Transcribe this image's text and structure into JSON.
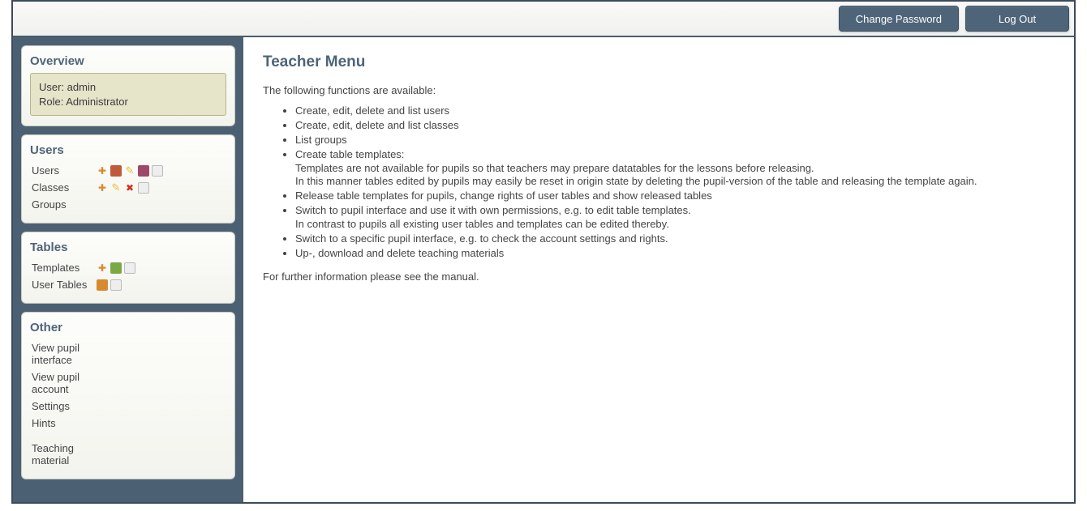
{
  "topbar": {
    "change_password": "Change Password",
    "log_out": "Log Out"
  },
  "sidebar": {
    "overview": {
      "heading": "Overview",
      "user_line": "User: admin",
      "role_line": "Role: Administrator"
    },
    "users": {
      "heading": "Users",
      "items": [
        {
          "label": "Users",
          "icons": [
            "add-user-icon",
            "group-icon",
            "edit-icon",
            "user-delete-icon",
            "list-icon"
          ]
        },
        {
          "label": "Classes",
          "icons": [
            "add-icon",
            "edit-icon",
            "delete-icon",
            "list-icon"
          ]
        },
        {
          "label": "Groups",
          "icons": []
        }
      ]
    },
    "tables": {
      "heading": "Tables",
      "items": [
        {
          "label": "Templates",
          "icons": [
            "add-icon",
            "release-icon",
            "list-icon"
          ]
        },
        {
          "label": "User Tables",
          "icons": [
            "rights-icon",
            "list-icon"
          ]
        }
      ]
    },
    "other": {
      "heading": "Other",
      "items": [
        {
          "label": "View pupil interface"
        },
        {
          "label": "View pupil account"
        },
        {
          "label": "Settings"
        },
        {
          "label": "Hints"
        },
        {
          "label": "Teaching material"
        }
      ]
    }
  },
  "main": {
    "title": "Teacher Menu",
    "intro": "The following functions are available:",
    "bullets": [
      {
        "text": "Create, edit, delete and list users"
      },
      {
        "text": "Create, edit, delete and list classes"
      },
      {
        "text": "List groups"
      },
      {
        "text": "Create table templates:",
        "sub": [
          "Templates are not available for pupils so that teachers may prepare datatables for the lessons before releasing.",
          "In this manner tables edited by pupils may easily be reset in origin state by deleting the pupil-version of the table and releasing the template again."
        ]
      },
      {
        "text": "Release table templates for pupils, change rights of user tables and show released tables"
      },
      {
        "text": "Switch to pupil interface and use it with own permissions, e.g. to edit table templates.",
        "sub": [
          "In contrast to pupils all existing user tables and templates can be edited thereby."
        ]
      },
      {
        "text": "Switch to a specific pupil interface, e.g. to check the account settings and rights."
      },
      {
        "text": "Up-, download and delete teaching materials"
      }
    ],
    "outro": "For further information please see the manual."
  },
  "icon_colors": {
    "add-user-icon": "#d88a2e",
    "group-icon": "#c05a3a",
    "edit-icon": "#e6c23a",
    "user-delete-icon": "#a0486a",
    "list-icon": "#b8b8b8",
    "add-icon": "#d88a2e",
    "delete-icon": "#d03020",
    "release-icon": "#7aa844",
    "rights-icon": "#d88a2e"
  }
}
